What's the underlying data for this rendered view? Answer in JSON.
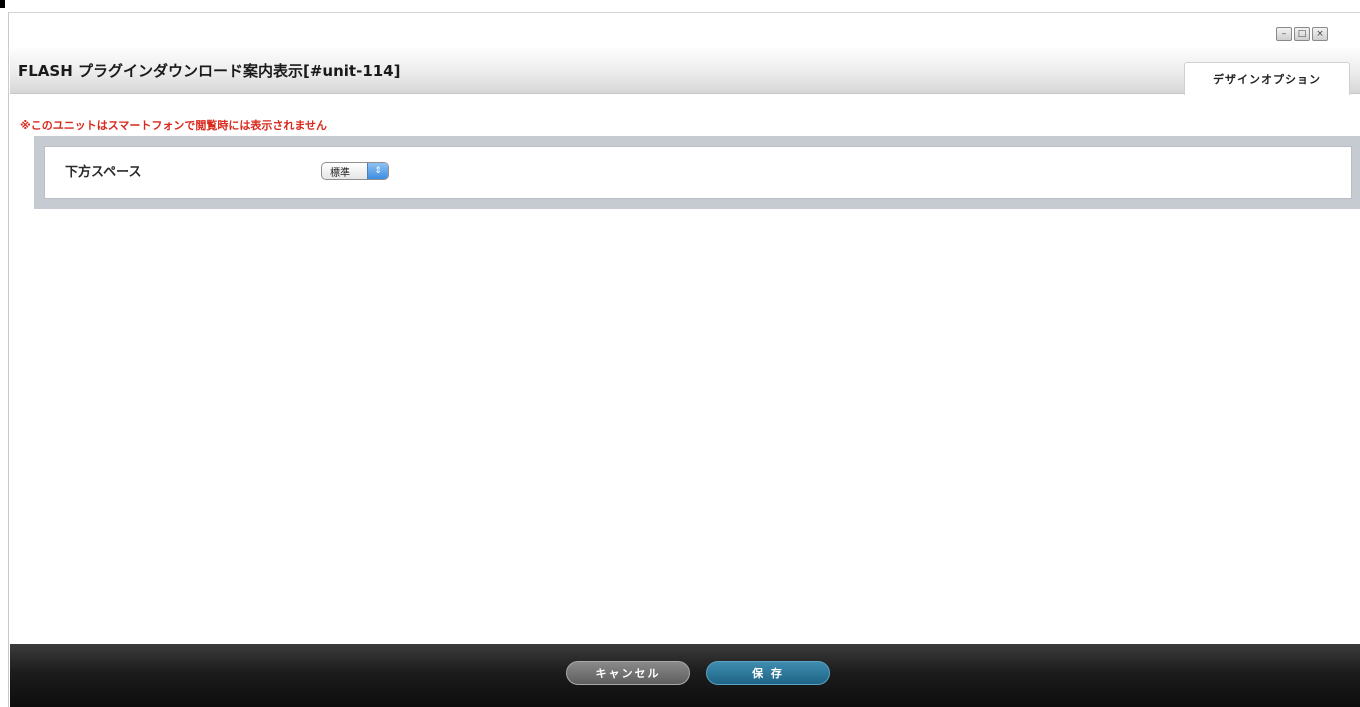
{
  "window": {
    "controls": [
      "–",
      "□",
      "×"
    ]
  },
  "header": {
    "title": "FLASH プラグインダウンロード案内表示[#unit-114]",
    "tab_label": "デザインオプション"
  },
  "notice": {
    "text": "※このユニットはスマートフォンで閲覧時には表示されません"
  },
  "settings": {
    "rows": [
      {
        "label": "下方スペース",
        "select_value": "標準",
        "stepper_glyph": "⇕"
      }
    ]
  },
  "footer": {
    "cancel_label": "キャンセル",
    "save_label": "保 存"
  },
  "colors": {
    "notice_red": "#d9281c",
    "save_blue": "#1f6486",
    "footer_black": "#0d0d0d",
    "settings_frame": "#c5cbd0"
  }
}
